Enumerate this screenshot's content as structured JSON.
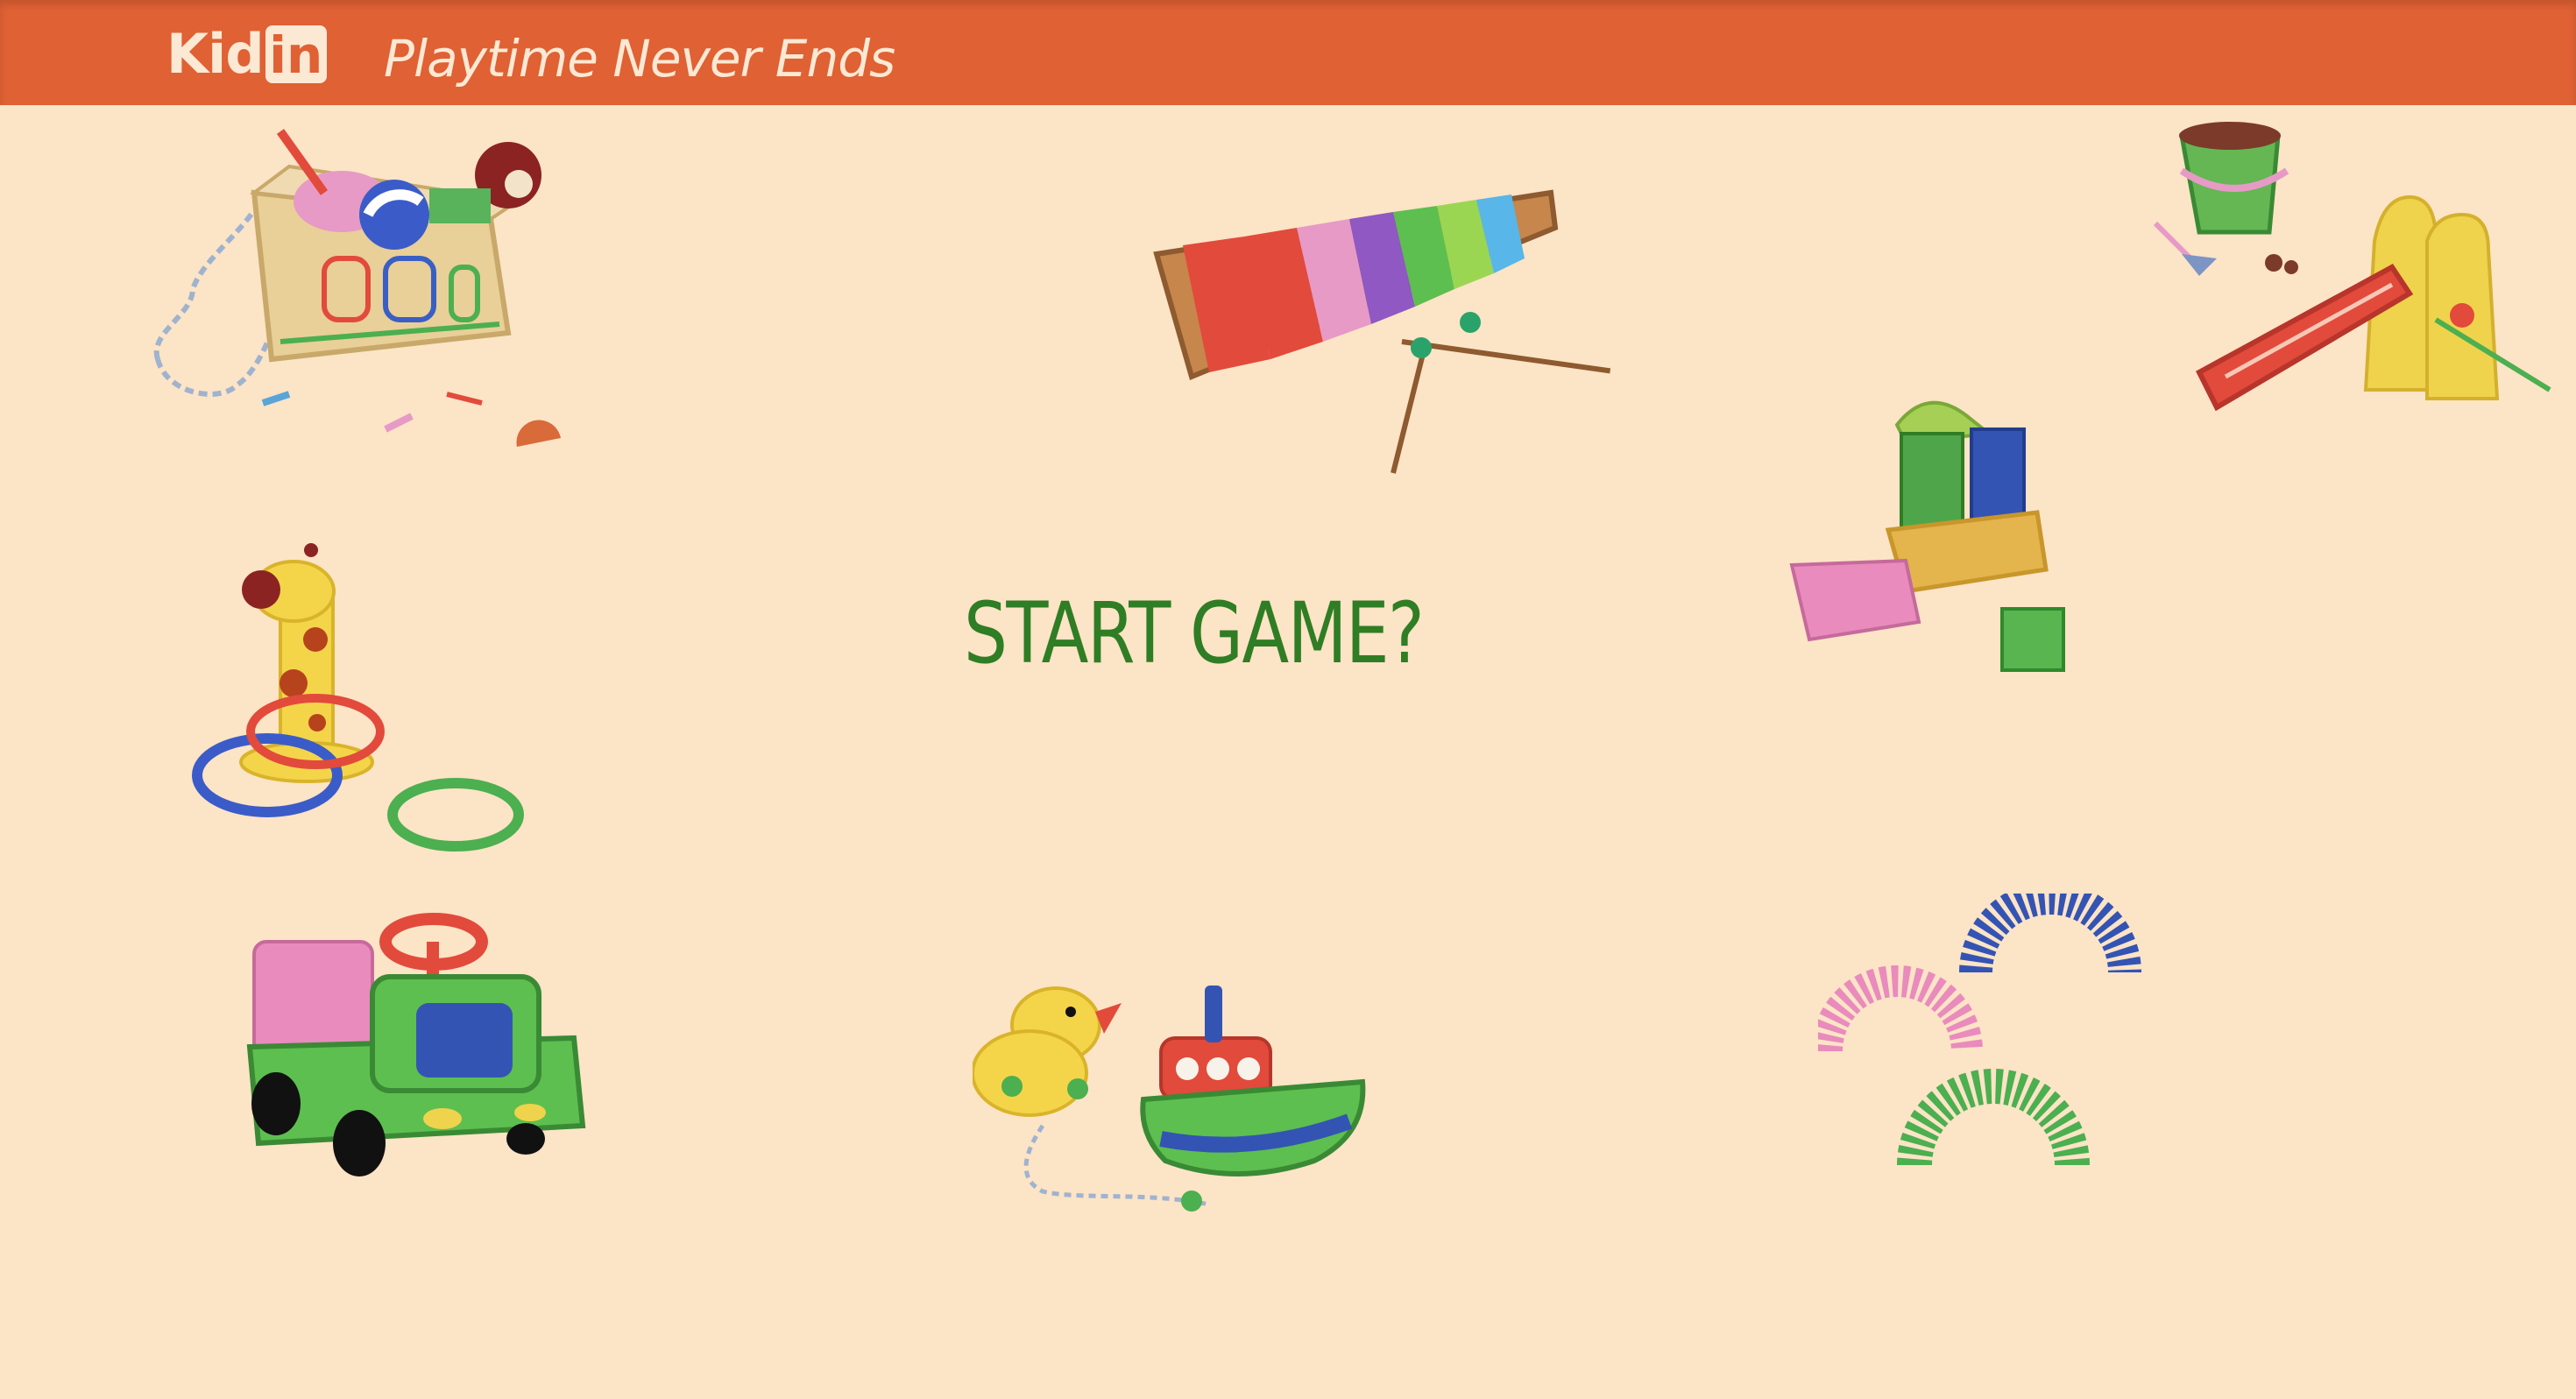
{
  "header": {
    "logo_text": "Kid",
    "logo_box_text": "in",
    "tagline": "Playtime Never Ends"
  },
  "main": {
    "start_label": "START GAME?"
  },
  "toys": [
    "toy-box-icon",
    "xylophone-icon",
    "playground-slide-icon",
    "building-blocks-icon",
    "giraffe-ring-toss-icon",
    "ride-on-car-icon",
    "duck-and-boat-icon",
    "rainbow-arches-icon"
  ],
  "colors": {
    "header": "#e06134",
    "background": "#fce4c6",
    "start_text": "#2f7d24",
    "header_text": "#fce9d4"
  }
}
